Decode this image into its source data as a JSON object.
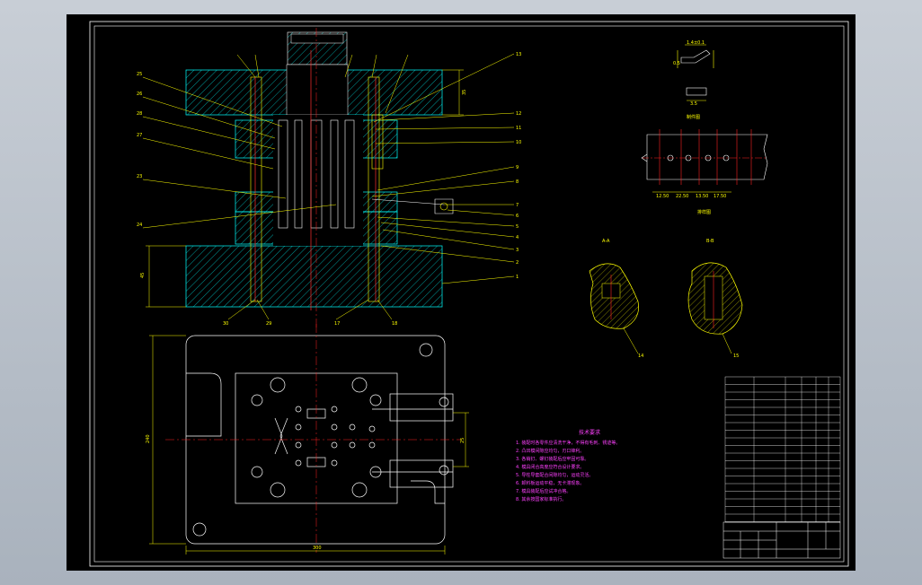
{
  "sheet": {
    "background": "#000000",
    "frame_color": "#ffffff",
    "line_colors": {
      "yellow": "#ffff00",
      "red": "#ff2020",
      "cyan": "#00ffff",
      "white": "#ffffff",
      "green": "#00ff00",
      "magenta": "#ff00ff"
    }
  },
  "views": {
    "section": {
      "part_labels_left": [
        "25",
        "26",
        "28",
        "27",
        "23",
        "24"
      ],
      "part_labels_right": [
        "13",
        "12",
        "11",
        "10",
        "9",
        "8",
        "7",
        "6",
        "5",
        "4",
        "3",
        "2",
        "1"
      ],
      "part_labels_bottom": [
        "30",
        "29",
        "17",
        "18"
      ],
      "dimension_left": "45",
      "dimension_right": "35"
    },
    "plan": {
      "dimension_width": "300",
      "dimension_height": "240",
      "dimension_right": "25"
    },
    "strip_layout": {
      "caption": "排样图",
      "dimensions": [
        "12.50",
        "22.50",
        "13.50",
        "17.50"
      ]
    },
    "detail_part": {
      "caption": "制件图",
      "dimensions": [
        "1.4±0.1",
        "0.5",
        "3.5"
      ]
    },
    "detail_a": {
      "caption": "A-A",
      "label": "14"
    },
    "detail_b": {
      "caption": "B-B",
      "label": "15"
    }
  },
  "notes": {
    "title": "技术要求",
    "lines": [
      "1. 装配时各零件应清洗干净，不得有毛刺、锈迹等。",
      "2. 凸凹模间隙应均匀，刃口锋利。",
      "3. 各销钉、螺钉装配后应牢固可靠。",
      "4. 模具闭合高度应符合设计要求。",
      "5. 导柱导套配合间隙均匀，运动灵活。",
      "6. 卸料板运动平稳，无卡滞现象。",
      "7. 模具装配后应试冲合格。",
      "8. 其余按国家标准执行。"
    ]
  }
}
